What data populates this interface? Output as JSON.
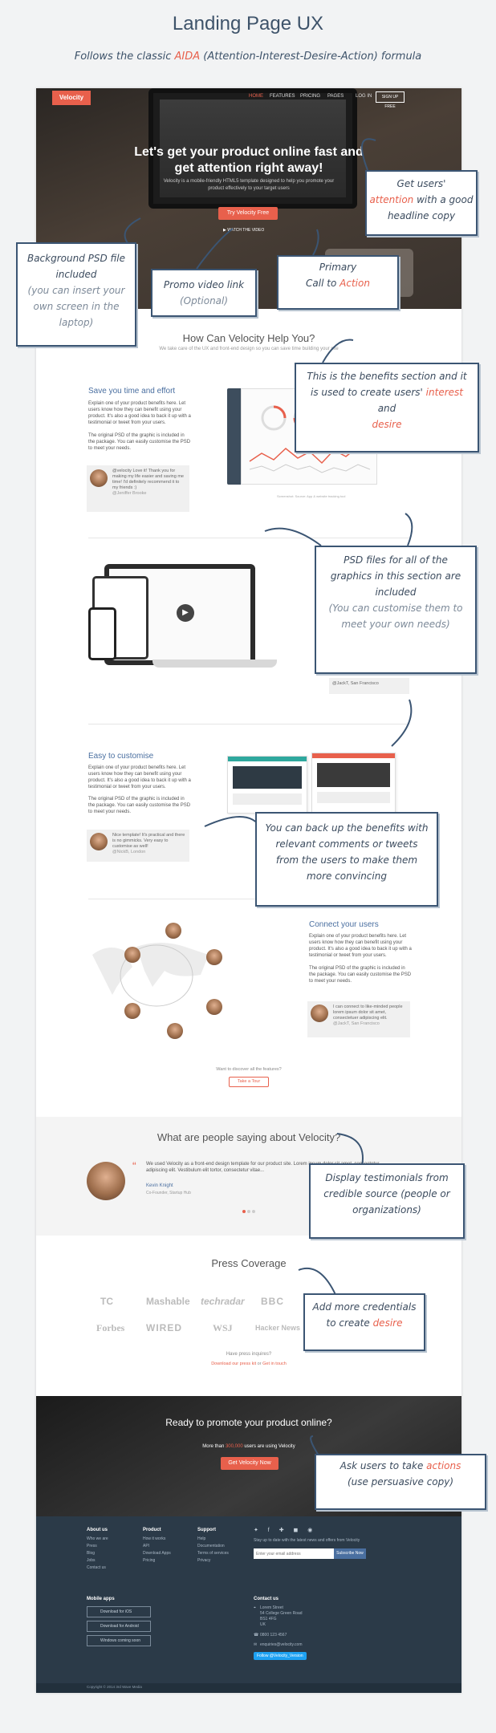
{
  "header": {
    "title": "Landing Page UX",
    "subtitle_pre": "Follows the classic ",
    "subtitle_aida": "AIDA",
    "subtitle_post": " (Attention-Interest-Desire-Action) formula"
  },
  "nav": {
    "logo": "Velocity",
    "items": [
      "HOME",
      "FEATURES",
      "PRICING",
      "PAGES",
      "LOG IN"
    ],
    "signup": "SIGN UP FREE"
  },
  "hero": {
    "headline": "Let's get your product online fast and get attention right away!",
    "desc": "Velocity is a mobile-friendly HTML5 template designed to help you promote your product effectively to your target users",
    "cta": "Try Velocity Free",
    "video": "WATCH THE VIDEO"
  },
  "help": {
    "title": "How Can Velocity Help You?",
    "subtitle": "We take care of the UX and front-end design so you can save time building your site"
  },
  "feature1": {
    "title": "Save you time and effort",
    "p1": "Explain one of your product benefits here. Let users know how they can benefit using your product. It's also a good idea to back it up with a testimonial or tweet from your users.",
    "p2": "The original PSD of the graphic is included in the package. You can easily customise the PSD to meet your needs.",
    "quote": "@velocity Love it! Thank you for making my life easier and saving me time! I'd definitely recommend it to my friends :)",
    "quote_by": "@Jeniffer Brooke",
    "caption": "Screenshot: Source: App & website tracking tool"
  },
  "feature2": {
    "quote_by": "@JackT, San Francisco"
  },
  "feature3": {
    "title": "Easy to customise",
    "p1": "Explain one of your product benefits here. Let users know how they can benefit using your product. It's also a good idea to back it up with a testimonial or tweet from your users.",
    "p2": "The original PSD of the graphic is included in the package. You can easily customise the PSD to meet your needs.",
    "quote": "Nice template! It's practical and there is no gimmicks. Very easy to customise as well!",
    "quote_by": "@NickB, London"
  },
  "feature4": {
    "title": "Connect your users",
    "p1": "Explain one of your product benefits here. Let users know how they can benefit using your product. It's also a good idea to back it up with a testimonial or tweet from your users.",
    "p2": "The original PSD of the graphic is included in the package. You can easily customise the PSD to meet your needs.",
    "quote": "I can connect to like-minded people lorem ipsum dolor sit amet, consectetuer adipiscing elit.",
    "quote_by": "@JackT, San Francisco"
  },
  "tour": {
    "text": "Want to discover all the features?",
    "button": "Take a Tour"
  },
  "testimonials": {
    "title": "What are people saying about Velocity?",
    "text": "We used Velocity as a front-end design template for our product site. Lorem ipsum dolor sit amet, consectetur adipiscing elit. Vestibulum elit tortor, consectetur vitae...",
    "name": "Kevin Knight",
    "role": "Co-Founder, Startup Hub"
  },
  "press": {
    "title": "Press Coverage",
    "logos": [
      "TC",
      "Mashable",
      "techradar",
      "BBC",
      "Forbes",
      "WIRED",
      "WSJ",
      "Hacker News"
    ],
    "enquiry": "Have press inquires?",
    "download": "Download our press kit",
    "or": " or ",
    "contact": "Get in touch"
  },
  "cta": {
    "title": "Ready to promote your product online?",
    "sub_pre": "More than ",
    "sub_num": "300,000",
    "sub_post": " users are using Velocity",
    "button": "Get Velocity Now"
  },
  "footer": {
    "cols": [
      {
        "title": "About us",
        "links": [
          "Who we are",
          "Press",
          "Blog",
          "Jobs",
          "Contact us"
        ]
      },
      {
        "title": "Product",
        "links": [
          "How it works",
          "API",
          "Download Apps",
          "Pricing"
        ]
      },
      {
        "title": "Support",
        "links": [
          "Help",
          "Documentation",
          "Terms of services",
          "Privacy"
        ]
      }
    ],
    "newsletter": "Stay up to date with the latest news and offers from Velocity",
    "email_placeholder": "Enter your email address",
    "subscribe": "Subscribe Now",
    "apps_title": "Mobile apps",
    "apps": [
      "Download for iOS",
      "Download for Android",
      "Windows coming soon"
    ],
    "contact_title": "Contact us",
    "address": [
      "Lorem Street",
      "54 College Green Road",
      "BS1 4FG",
      "UK"
    ],
    "phone": "0800 123 4567",
    "email": "enquiries@velocity.com",
    "follow": "Follow @Velocity_Version",
    "copyright": "Copyright © 2014 3rd Wave Media"
  },
  "callouts": {
    "attention": [
      "Get users'",
      "attention",
      "with a good headline copy"
    ],
    "bg": [
      "Background PSD file included",
      "(you can insert your own screen in the laptop)"
    ],
    "promo": [
      "Promo video link",
      "(Optional)"
    ],
    "primary": [
      "Primary",
      "Call to",
      "Action"
    ],
    "benefits": [
      "This is the benefits section and it is used to create users'",
      "interest",
      "and",
      "desire"
    ],
    "psd": [
      "PSD files for all of the graphics in this section are included",
      "(You can customise them to meet your own needs)"
    ],
    "backup": [
      "You can back up the benefits with relevant comments or tweets from the users to make them more convincing"
    ],
    "testimonials": [
      "Display testimonials from credible source (people or organizations)"
    ],
    "credentials": [
      "Add more credentials to create",
      "desire"
    ],
    "actions": [
      "Ask users to take",
      "actions",
      "(use persuasive copy)"
    ]
  },
  "colors": {
    "accent": "#e8604c",
    "ink": "#3b4b5e",
    "footer": "#2b3a48"
  }
}
